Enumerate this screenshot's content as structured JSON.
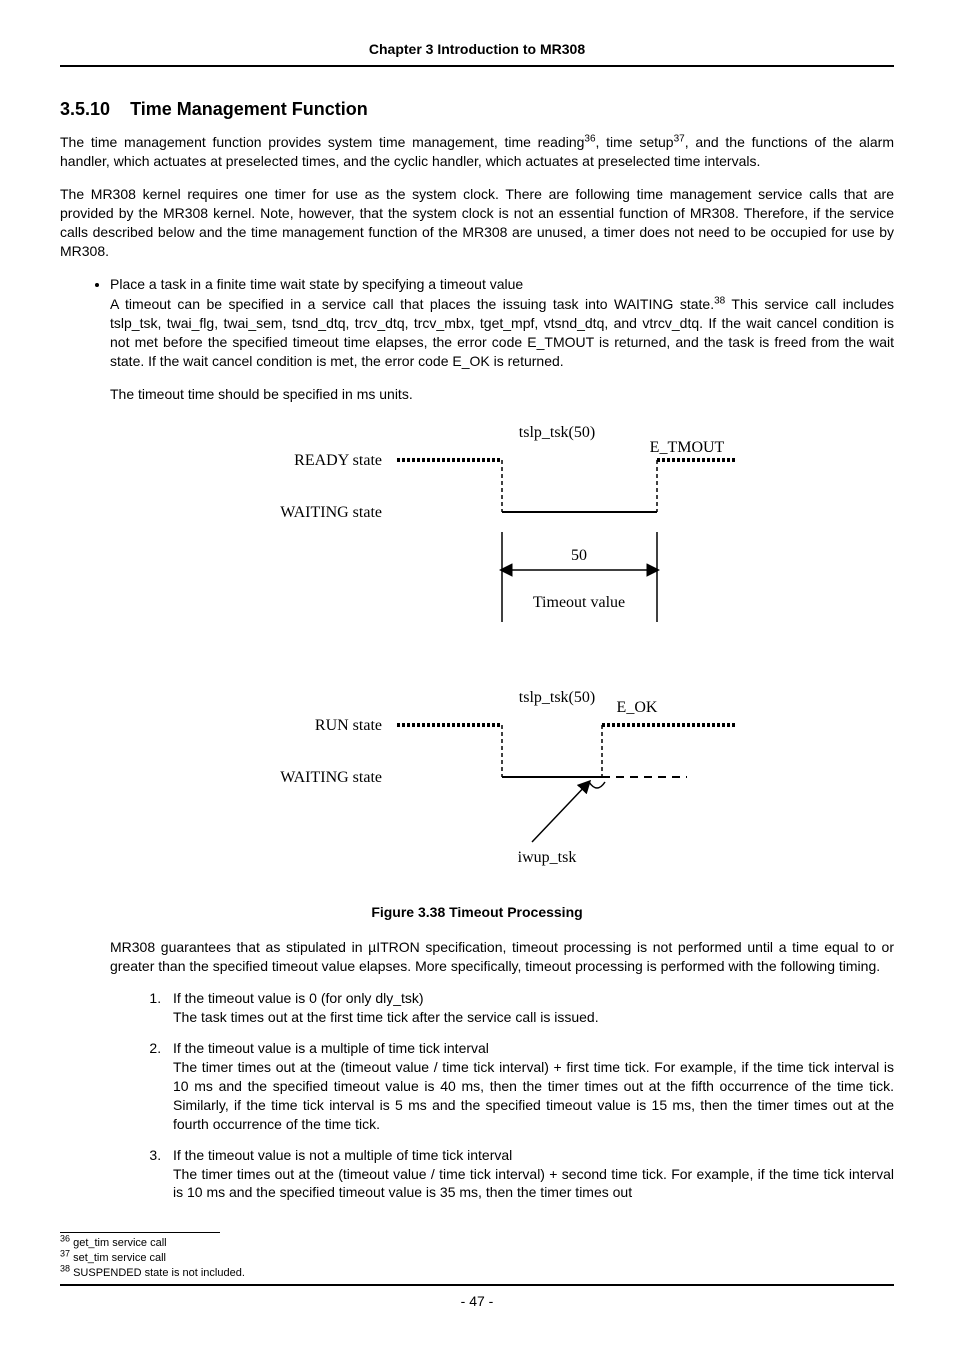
{
  "chapter_header": "Chapter 3 Introduction to MR308",
  "section_number": "3.5.10",
  "section_title": "Time Management Function",
  "p1_a": "The time management function provides system time management, time reading",
  "p1_b": ", time setup",
  "p1_c": ", and the functions of the alarm handler, which actuates at preselected times, and the cyclic handler, which actuates at preselected time intervals.",
  "fn36": "36",
  "fn37": "37",
  "p2": "The MR308 kernel requires one timer for use as the system clock. There are following time management service calls that are provided by the MR308 kernel. Note, however, that the system clock is not an essential function of MR308. Therefore, if the service calls described below and the time management function of the MR308 are unused, a timer does not need to be occupied for use by MR308.",
  "bullet1": "Place a task in a finite time wait state by specifying a timeout value",
  "ba_a": "A timeout can be specified in a service call that places the issuing task into WAITING state.",
  "fn38": "38",
  "ba_b": " This service call includes tslp_tsk, twai_flg, twai_sem, tsnd_dtq, trcv_dtq, trcv_mbx, tget_mpf, vtsnd_dtq, and vtrcv_dtq. If the wait cancel condition is not met before the specified timeout time elapses, the error code E_TMOUT is returned, and the task is freed from the wait state. If the wait cancel condition is met, the error code E_OK is returned.",
  "bb": "The timeout time should be specified in ms units.",
  "fig": {
    "ready": "READY state",
    "waiting": "WAITING state",
    "run": "RUN state",
    "tslp": "tslp_tsk(50)",
    "etmout": "E_TMOUT",
    "eok": "E_OK",
    "fifty": "50",
    "timeout_val": "Timeout value",
    "iwup": "iwup_tsk"
  },
  "fig_caption": "Figure 3.38 Timeout Processing",
  "p_after_fig": "MR308 guarantees that as stipulated in µITRON specification, timeout processing is not performed until a time equal to or greater than the specified timeout value elapses. More specifically, timeout processing is performed with the following timing.",
  "li1_head": "If the timeout value is 0 (for only dly_tsk)",
  "li1_body": "The task times out at the first time tick after the service call is issued.",
  "li2_head": "If the timeout value is a multiple of time tick interval",
  "li2_body": "The timer times out at the (timeout value / time tick interval) + first time tick. For example, if the time tick interval is 10 ms and the specified timeout value is 40 ms, then the timer times out at the fifth occurrence of the time tick. Similarly, if the time tick interval is 5 ms and the specified timeout value is 15 ms, then the timer times out at the fourth occurrence of the time tick.",
  "li3_head": "If the timeout value is not a multiple of time tick interval",
  "li3_body": "The timer times out at the (timeout value / time tick interval) + second time tick. For example, if the time tick interval is 10 ms and the specified timeout value is 35 ms, then the timer times out",
  "footnote36": "get_tim service call",
  "footnote37": "set_tim service call",
  "footnote38": "SUSPENDED state is not included.",
  "page_num": "- 47 -"
}
